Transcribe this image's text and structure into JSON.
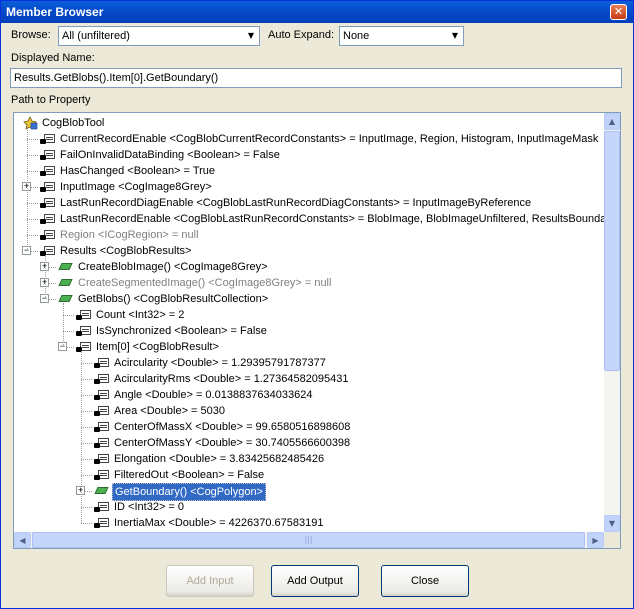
{
  "window": {
    "title": "Member Browser",
    "close_glyph": "✕"
  },
  "browse": {
    "label": "Browse:",
    "value": "All (unfiltered)"
  },
  "auto_expand": {
    "label": "Auto Expand:",
    "value": "None"
  },
  "displayed_name": {
    "label": "Displayed Name:",
    "value": "Results.GetBlobs().Item[0].GetBoundary()"
  },
  "path_label": "Path to Property",
  "tree": [
    {
      "text": "CogBlobTool",
      "icon": "tool-icon",
      "expander": "−",
      "state": "normal"
    },
    {
      "text": "CurrentRecordEnable <CogBlobCurrentRecordConstants> = InputImage, Region, Histogram, InputImageMask",
      "icon": "property-icon",
      "state": "normal"
    },
    {
      "text": "FailOnInvalidDataBinding <Boolean> = False",
      "icon": "property-icon",
      "state": "normal"
    },
    {
      "text": "HasChanged <Boolean> = True",
      "icon": "property-icon",
      "state": "normal"
    },
    {
      "text": "InputImage <CogImage8Grey>",
      "icon": "property-icon",
      "expander": "+",
      "state": "normal"
    },
    {
      "text": "LastRunRecordDiagEnable <CogBlobLastRunRecordDiagConstants> = InputImageByReference",
      "icon": "property-icon",
      "state": "normal"
    },
    {
      "text": "LastRunRecordEnable <CogBlobLastRunRecordConstants> = BlobImage, BlobImageUnfiltered, ResultsBoundar",
      "icon": "property-icon",
      "state": "normal"
    },
    {
      "text": "Region <ICogRegion> = null",
      "icon": "property-icon",
      "state": "gray"
    },
    {
      "text": "Results <CogBlobResults>",
      "icon": "property-icon",
      "expander": "−",
      "state": "normal"
    },
    {
      "text": "CreateBlobImage() <CogImage8Grey>",
      "icon": "method-icon",
      "expander": "+",
      "state": "normal"
    },
    {
      "text": "CreateSegmentedImage() <CogImage8Grey> = null",
      "icon": "method-icon",
      "expander": "+",
      "state": "gray"
    },
    {
      "text": "GetBlobs() <CogBlobResultCollection>",
      "icon": "method-icon",
      "expander": "−",
      "state": "normal"
    },
    {
      "text": "Count <Int32> = 2",
      "icon": "property-icon",
      "state": "normal"
    },
    {
      "text": "IsSynchronized <Boolean> = False",
      "icon": "property-icon",
      "state": "normal"
    },
    {
      "text": "Item[0] <CogBlobResult>",
      "icon": "property-icon",
      "expander": "−",
      "state": "normal"
    },
    {
      "text": "Acircularity <Double> = 1.29395791787377",
      "icon": "property-icon",
      "state": "normal"
    },
    {
      "text": "AcircularityRms <Double> = 1.27364582095431",
      "icon": "property-icon",
      "state": "normal"
    },
    {
      "text": "Angle <Double> = 0.0138837634033624",
      "icon": "property-icon",
      "state": "normal"
    },
    {
      "text": "Area <Double> = 5030",
      "icon": "property-icon",
      "state": "normal"
    },
    {
      "text": "CenterOfMassX <Double> = 99.6580516898608",
      "icon": "property-icon",
      "state": "normal"
    },
    {
      "text": "CenterOfMassY <Double> = 30.7405566600398",
      "icon": "property-icon",
      "state": "normal"
    },
    {
      "text": "Elongation <Double> = 3.83425682485426",
      "icon": "property-icon",
      "state": "normal"
    },
    {
      "text": "FilteredOut <Boolean> = False",
      "icon": "property-icon",
      "state": "normal"
    },
    {
      "text": "GetBoundary() <CogPolygon>",
      "icon": "method-icon",
      "expander": "+",
      "state": "selected"
    },
    {
      "text": "ID <Int32> = 0",
      "icon": "property-icon",
      "state": "normal"
    },
    {
      "text": "InertiaMax <Double> = 4226370.67583191",
      "icon": "property-icon",
      "state": "normal"
    }
  ],
  "buttons": {
    "add_input": "Add Input",
    "add_output": "Add Output",
    "close": "Close"
  }
}
